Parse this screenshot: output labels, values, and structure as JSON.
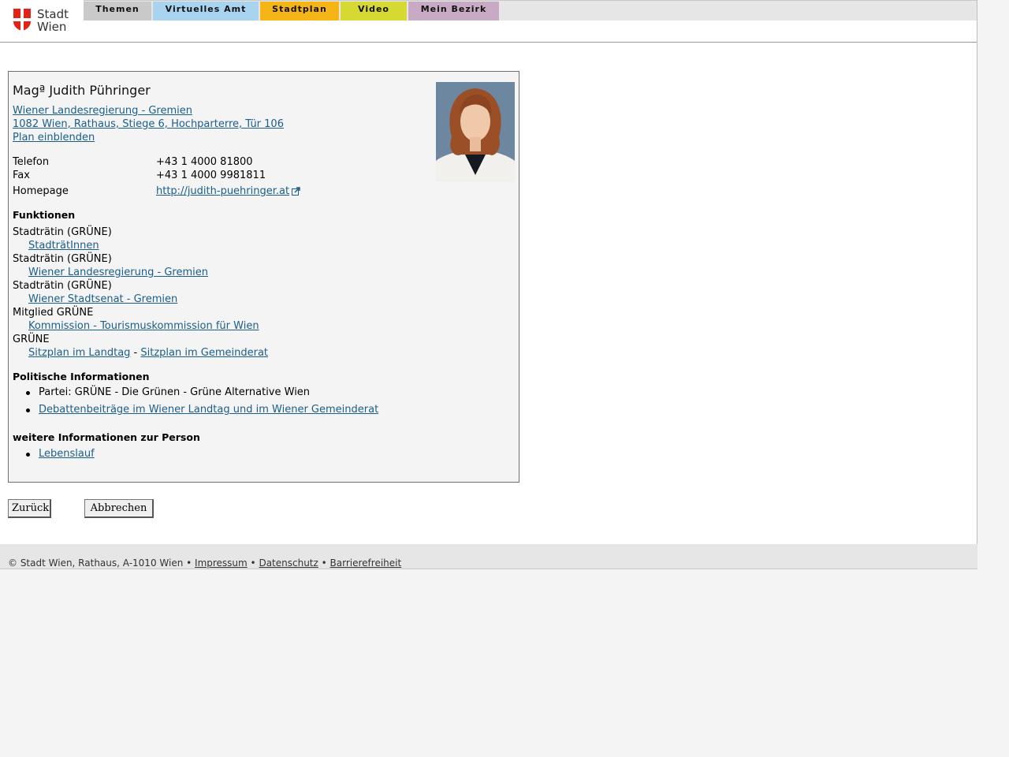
{
  "header": {
    "logo_text_line1": "Stadt",
    "logo_text_line2": "Wien",
    "nav": [
      {
        "label": "Themen",
        "color": "#c9c9c9"
      },
      {
        "label": "Virtuelles Amt",
        "color": "#a9d4f0"
      },
      {
        "label": "Stadtplan",
        "color": "#f5b517"
      },
      {
        "label": "Video",
        "color": "#d6d833"
      },
      {
        "label": "Mein Bezirk",
        "color": "#c8aac4"
      }
    ]
  },
  "person": {
    "name": "Magª Judith Pühringer",
    "org_link": "Wiener Landesregierung - Gremien ",
    "address_link": "1082 Wien, Rathaus, Stiege 6, Hochparterre, Tür 106",
    "plan_link": "Plan einblenden",
    "contact": [
      {
        "label": "Telefon",
        "value": "+43 1 4000 81800"
      },
      {
        "label": "Fax",
        "value": "+43 1 4000 9981811"
      },
      {
        "label": "Homepage",
        "value": "http://judith-puehringer.at"
      }
    ]
  },
  "funktionen": {
    "title": "Funktionen",
    "items": [
      {
        "role": "Stadträtin (GRÜNE)",
        "links": [
          "StadträtInnen"
        ]
      },
      {
        "role": "Stadträtin (GRÜNE)",
        "links": [
          "Wiener Landesregierung - Gremien"
        ]
      },
      {
        "role": "Stadträtin (GRÜNE)",
        "links": [
          "Wiener Stadtsenat - Gremien"
        ]
      },
      {
        "role": "Mitglied GRÜNE",
        "links": [
          "Kommission - Tourismuskommission für Wien"
        ]
      },
      {
        "role": "GRÜNE",
        "links": [
          "Sitzplan im Landtag",
          "Sitzplan im Gemeinderat"
        ],
        "separator": " - "
      }
    ]
  },
  "politisch": {
    "title": "Politische Informationen",
    "party": "Partei: GRÜNE - Die Grünen - Grüne Alternative Wien",
    "debate_link": "Debattenbeiträge im Wiener Landtag und im Wiener Gemeinderat"
  },
  "weitere": {
    "title": "weitere Informationen zur Person",
    "cv_link": "Lebenslauf"
  },
  "buttons": {
    "back": "Zurück",
    "cancel": "Abbrechen"
  },
  "footer": {
    "copyright": "© Stadt Wien, Rathaus, A-1010 Wien",
    "sep": " • ",
    "links": [
      "Impressum",
      "Datenschutz",
      "Barrierefreiheit"
    ]
  }
}
